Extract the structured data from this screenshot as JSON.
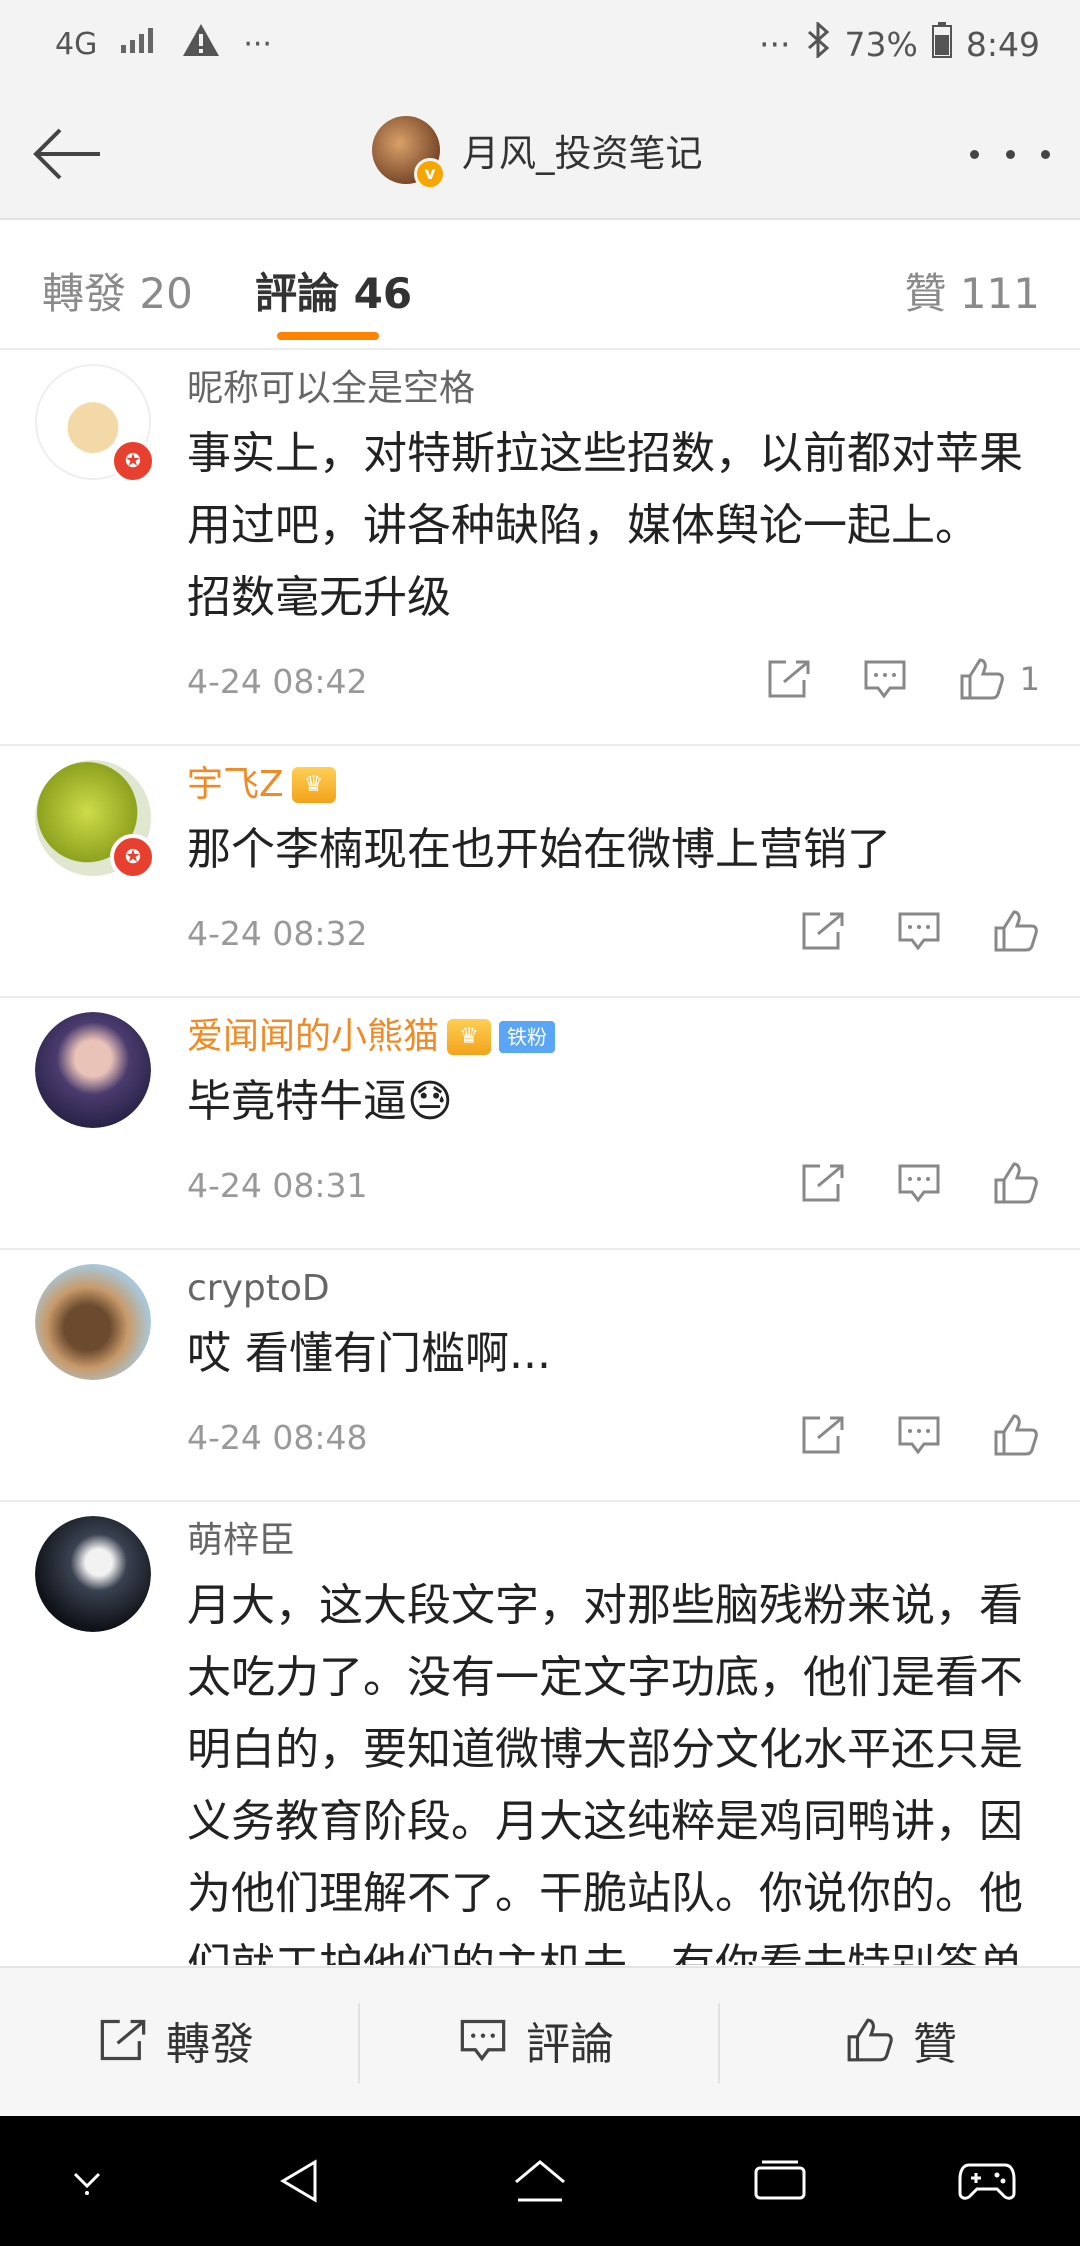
{
  "status_bar": {
    "network": "4G",
    "more_left": "···",
    "more_right": "···",
    "battery": "73%",
    "time": "8:49"
  },
  "nav": {
    "title": "月风_投资笔记"
  },
  "tabs": {
    "repost": "轉發 20",
    "comments": "評論 46",
    "likes": "贊 111"
  },
  "comments": [
    {
      "user": "昵称可以全是空格",
      "name_color": "gray",
      "text_lines": [
        "事实上，对特斯拉这些招数，以前都对苹果",
        "用过吧，讲各种缺陷，媒体舆论一起上。",
        "招数毫无升级"
      ],
      "time": "4-24 08:42",
      "likes": "1"
    },
    {
      "user": "宇飞Z",
      "name_color": "orange",
      "text_lines": [
        "那个李楠现在也开始在微博上营销了"
      ],
      "time": "4-24 08:32",
      "likes": ""
    },
    {
      "user": "爱闻闻的小熊猫",
      "name_color": "orange",
      "fan_badge": "铁粉",
      "text_lines": [
        "毕竟特牛逼😓"
      ],
      "time": "4-24 08:31",
      "likes": ""
    },
    {
      "user": "cryptoD",
      "name_color": "gray",
      "text_lines": [
        "哎 看懂有门槛啊..."
      ],
      "time": "4-24 08:48",
      "likes": ""
    },
    {
      "user": "萌梓臣",
      "name_color": "gray",
      "text_lines": [
        "月大，这大段文字，对那些脑残粉来说，看",
        "太吃力了。没有一定文字功底，他们是看不",
        "明白的，要知道微博大部分文化水平还只是",
        "义务教育阶段。月大这纯粹是鸡同鸭讲，因",
        "为他们理解不了。干脆站队。你说你的。他",
        "们就工护他们的主机去。有你看去特别答单"
      ],
      "time": "",
      "likes": ""
    }
  ],
  "bottom_bar": {
    "repost": "轉發",
    "comment": "評論",
    "like": "贊"
  },
  "colors": {
    "accent": "#ff8200",
    "orange_name": "#f08a24",
    "badge_red": "#e8402f",
    "fan_badge": "#5aa6f5"
  }
}
